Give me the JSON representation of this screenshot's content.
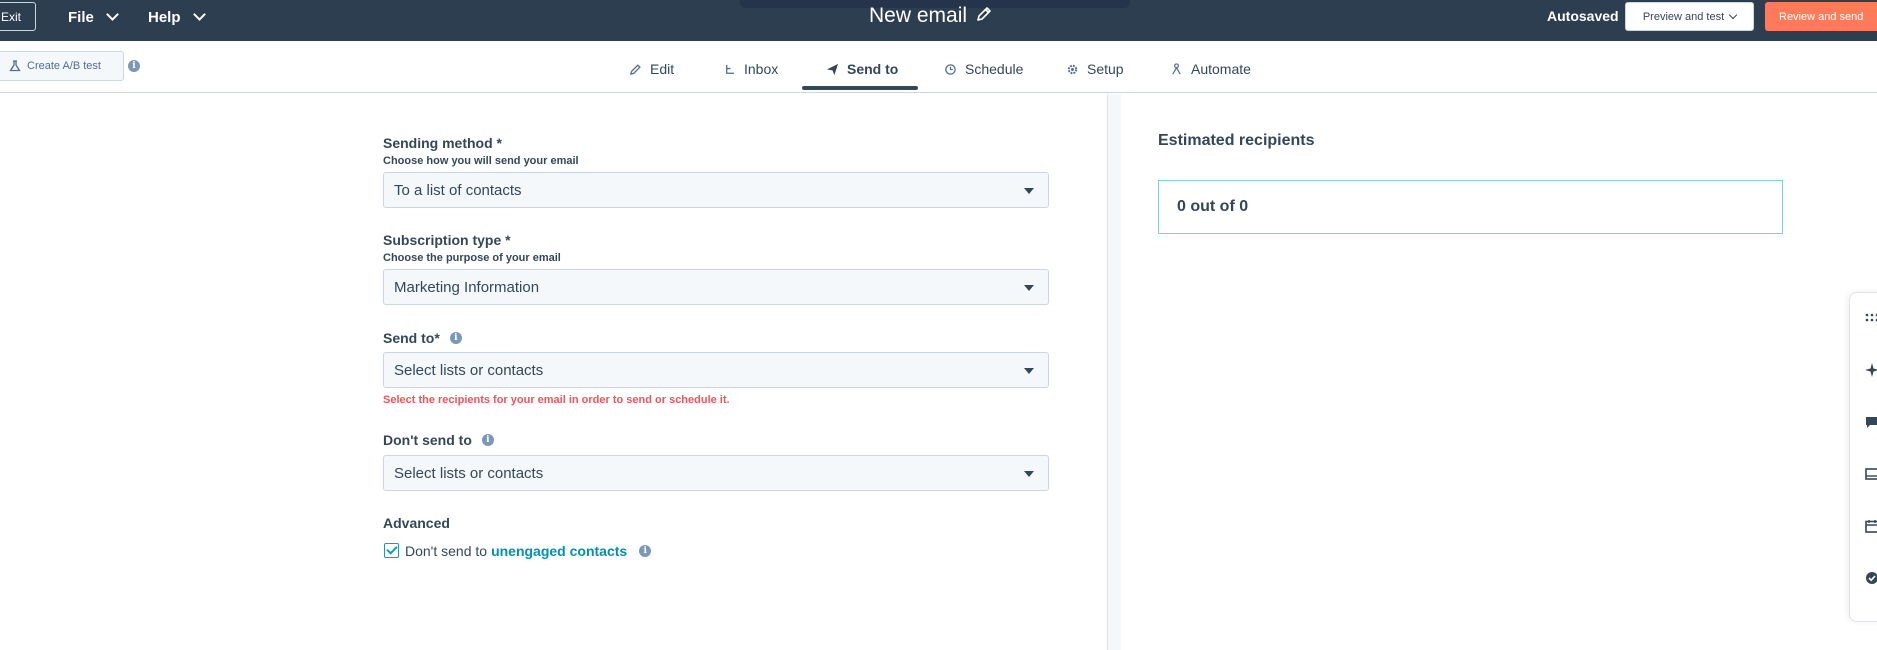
{
  "topbar": {
    "exit_label": "Exit",
    "file_label": "File",
    "help_label": "Help",
    "title": "New email",
    "autosaved": "Autosaved",
    "preview_label": "Preview and test",
    "review_label": "Review and send"
  },
  "subbar": {
    "ab_test_label": "Create A/B test",
    "tabs": [
      {
        "label": "Edit",
        "icon": "pencil-icon"
      },
      {
        "label": "Inbox",
        "icon": "inbox-icon"
      },
      {
        "label": "Send to",
        "icon": "send-icon",
        "active": true
      },
      {
        "label": "Schedule",
        "icon": "clock-icon"
      },
      {
        "label": "Setup",
        "icon": "gear-icon"
      },
      {
        "label": "Automate",
        "icon": "automate-icon"
      }
    ]
  },
  "form": {
    "sending_method": {
      "label": "Sending method *",
      "help": "Choose how you will send your email",
      "value": "To a list of contacts"
    },
    "subscription_type": {
      "label": "Subscription type *",
      "help": "Choose the purpose of your email",
      "value": "Marketing Information"
    },
    "send_to": {
      "label": "Send to*",
      "value": "Select lists or contacts",
      "error": "Select the recipients for your email in order to send or schedule it."
    },
    "dont_send_to": {
      "label": "Don't send to",
      "value": "Select lists or contacts"
    },
    "advanced": {
      "label": "Advanced",
      "checkbox_text": "Don't send to",
      "checkbox_link": "unengaged contacts",
      "checked": true
    }
  },
  "recipients": {
    "title": "Estimated recipients",
    "count_text": "0 out of 0"
  },
  "colors": {
    "topbar": "#2d3e50",
    "accent": "#ff7a59",
    "link": "#0091ae",
    "error": "#f2545b"
  }
}
